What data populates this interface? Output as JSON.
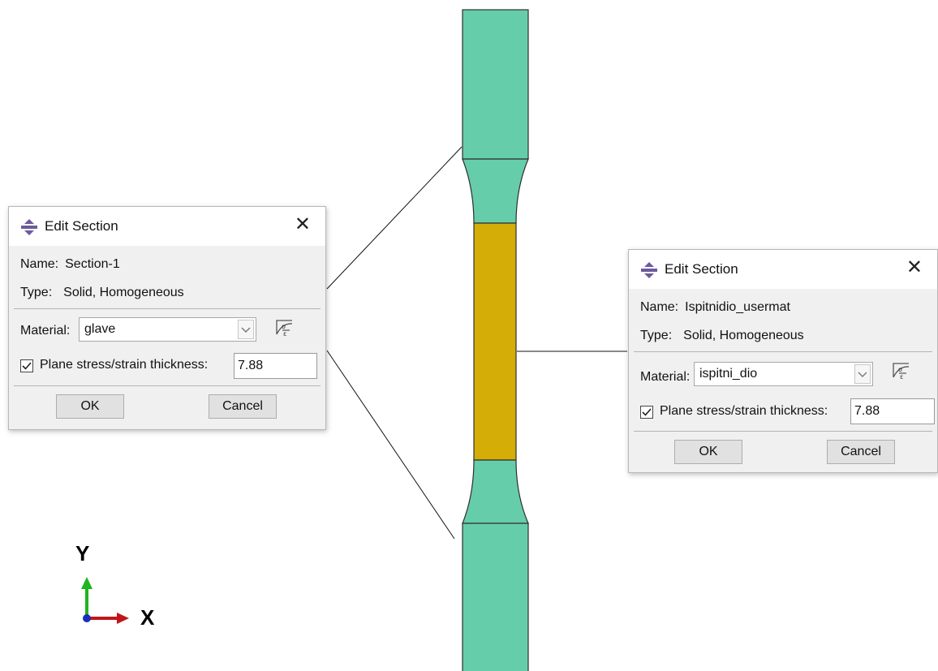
{
  "left_dialog": {
    "title": "Edit Section",
    "name_label": "Name:",
    "name_value": "Section-1",
    "type_label": "Type:",
    "type_value": "Solid, Homogeneous",
    "material_label": "Material:",
    "material_value": "glave",
    "thickness_checked": true,
    "thickness_label": "Plane stress/strain thickness:",
    "thickness_value": "7.88",
    "ok_label": "OK",
    "cancel_label": "Cancel"
  },
  "right_dialog": {
    "title": "Edit Section",
    "name_label": "Name:",
    "name_value": "Ispitnidio_usermat",
    "type_label": "Type:",
    "type_value": "Solid, Homogeneous",
    "material_label": "Material:",
    "material_value": "ispitni_dio",
    "thickness_checked": true,
    "thickness_label": "Plane stress/strain thickness:",
    "thickness_value": "7.88",
    "ok_label": "OK",
    "cancel_label": "Cancel"
  },
  "triad": {
    "y_label": "Y",
    "x_label": "X"
  },
  "icons": {
    "title": "section-icon",
    "close": "close-icon",
    "dropdown": "chevron-down-icon",
    "material_manager": "material-manager-icon",
    "checkbox": "checkmark-icon"
  },
  "colors": {
    "grip_region": "#66cdaa",
    "gauge_region": "#d4ad07",
    "triad_y": "#1fb51f",
    "triad_x": "#c0161b",
    "triad_z": "#1a2fb5",
    "icon_purple": "#6e5a9e"
  }
}
